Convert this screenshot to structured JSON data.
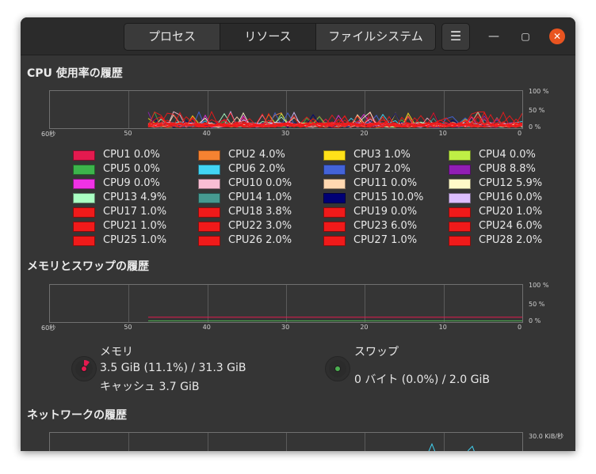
{
  "tabs": [
    "プロセス",
    "リソース",
    "ファイルシステム"
  ],
  "window_controls": {
    "menu": "☰",
    "minimize": "—",
    "maximize": "▢",
    "close": "✕"
  },
  "cpu_section": {
    "title": "CPU 使用率の履歴",
    "x_ticks": [
      "60秒",
      "50",
      "40",
      "30",
      "20",
      "10",
      "0"
    ],
    "y_ticks": [
      "100 %",
      "50 %",
      "0 %"
    ],
    "cpus": [
      {
        "label": "CPU1 0.0%",
        "color": "#e41a4f"
      },
      {
        "label": "CPU2 4.0%",
        "color": "#f58231"
      },
      {
        "label": "CPU3 1.0%",
        "color": "#ffe119"
      },
      {
        "label": "CPU4 0.0%",
        "color": "#bfef45"
      },
      {
        "label": "CPU5 0.0%",
        "color": "#3cb44b"
      },
      {
        "label": "CPU6 2.0%",
        "color": "#42d4f4"
      },
      {
        "label": "CPU7 2.0%",
        "color": "#4363d8"
      },
      {
        "label": "CPU8 8.8%",
        "color": "#911eb4"
      },
      {
        "label": "CPU9 0.0%",
        "color": "#f032e6"
      },
      {
        "label": "CPU10 0.0%",
        "color": "#fabed4"
      },
      {
        "label": "CPU11 0.0%",
        "color": "#ffd8b1"
      },
      {
        "label": "CPU12 5.9%",
        "color": "#fffac8"
      },
      {
        "label": "CPU13 4.9%",
        "color": "#aaffc3"
      },
      {
        "label": "CPU14 1.0%",
        "color": "#469990"
      },
      {
        "label": "CPU15 10.0%",
        "color": "#000075"
      },
      {
        "label": "CPU16 0.0%",
        "color": "#dcbeff"
      },
      {
        "label": "CPU17 1.0%",
        "color": "#f01a1a"
      },
      {
        "label": "CPU18 3.8%",
        "color": "#f01a1a"
      },
      {
        "label": "CPU19 0.0%",
        "color": "#f01a1a"
      },
      {
        "label": "CPU20 1.0%",
        "color": "#f01a1a"
      },
      {
        "label": "CPU21 1.0%",
        "color": "#f01a1a"
      },
      {
        "label": "CPU22 3.0%",
        "color": "#f01a1a"
      },
      {
        "label": "CPU23 6.0%",
        "color": "#f01a1a"
      },
      {
        "label": "CPU24 6.0%",
        "color": "#f01a1a"
      },
      {
        "label": "CPU25 1.0%",
        "color": "#f01a1a"
      },
      {
        "label": "CPU26 2.0%",
        "color": "#f01a1a"
      },
      {
        "label": "CPU27 1.0%",
        "color": "#f01a1a"
      },
      {
        "label": "CPU28 2.0%",
        "color": "#f01a1a"
      }
    ]
  },
  "memory_section": {
    "title": "メモリとスワップの履歴",
    "x_ticks": [
      "60秒",
      "50",
      "40",
      "30",
      "20",
      "10",
      "0"
    ],
    "y_ticks": [
      "100 %",
      "50 %",
      "0 %"
    ],
    "memory_title": "メモリ",
    "memory_usage": "3.5 GiB (11.1%) / 31.3 GiB",
    "cache": "キャッシュ 3.7 GiB",
    "memory_color": "#e41a4f",
    "memory_fraction": 0.111,
    "swap_title": "スワップ",
    "swap_usage": "0 バイト (0.0%) / 2.0 GiB",
    "swap_color": "#4caf50",
    "swap_fraction": 0.0
  },
  "network_section": {
    "title": "ネットワークの履歴",
    "y_tick_top": "30.0 KiB/秒"
  }
}
